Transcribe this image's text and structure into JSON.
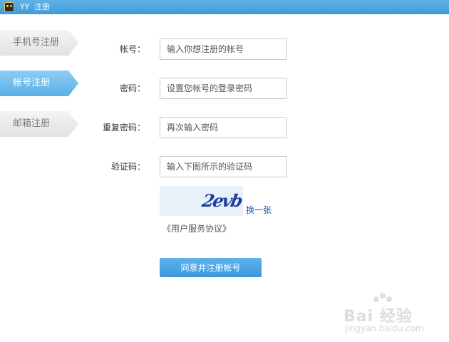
{
  "window": {
    "title": "YY 注册"
  },
  "sidebar": {
    "tabs": [
      {
        "label": "手机号注册",
        "active": false
      },
      {
        "label": "帐号注册",
        "active": true
      },
      {
        "label": "邮箱注册",
        "active": false
      }
    ]
  },
  "form": {
    "account": {
      "label": "帐号：",
      "value": "",
      "placeholder": "输入你想注册的帐号"
    },
    "password": {
      "label": "密码：",
      "value": "",
      "placeholder": "设置您帐号的登录密码"
    },
    "confirm": {
      "label": "重复密码：",
      "value": "",
      "placeholder": "再次输入密码"
    },
    "captcha": {
      "label": "验证码：",
      "value": "",
      "placeholder": "输入下图所示的验证码"
    },
    "captcha_image_text": "2evb",
    "refresh_label": "换一张",
    "agreement_label": "《用户服务协议》",
    "submit_label": "同意并注册帐号"
  },
  "watermark": {
    "main": "Bai 经验",
    "sub": "jingyan.baidu.com"
  },
  "colors": {
    "accent": "#3d97da",
    "titlebar": "#4fa8e2",
    "link": "#1a5ea8"
  }
}
